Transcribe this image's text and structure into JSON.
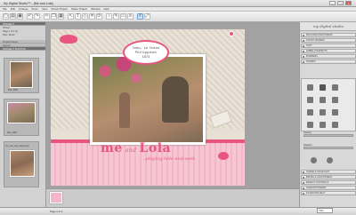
{
  "window": {
    "title": "My Digital Studio™ - [Me and Lola]"
  },
  "menu": [
    "File",
    "Edit",
    "Arrange",
    "Zoom",
    "View",
    "Check Project",
    "Share Project",
    "Window",
    "Help"
  ],
  "toolbar": {
    "icons": [
      "new-icon",
      "open-icon",
      "save-icon",
      "undo-icon",
      "redo-icon",
      "cut-icon",
      "copy-icon",
      "paste-icon",
      "select-icon",
      "text-icon",
      "shape-icon",
      "crop-icon",
      "rotate-icon",
      "music-icon",
      "pen-icon",
      "eraser-icon",
      "align-icon",
      "grid-icon",
      "fullscreen-icon"
    ]
  },
  "left_panel": {
    "tabs": [
      "PROJECT",
      "Project Panel",
      "Layout",
      "PROJECT PHOTOS"
    ],
    "info_lines": [
      "Photos",
      "Page 1 of 2 (1)",
      "Size: 12x12"
    ],
    "photos": [
      "IMG_0081",
      "IMG_0082",
      "me_and_lola_original.jpg"
    ]
  },
  "page": {
    "label_lines": [
      "Cebu, Le Union",
      "Philippines",
      "1973"
    ],
    "title_me": "me",
    "title_and": "and",
    "title_lola": "Lola",
    "subtitle": "...playing hide-and-seek"
  },
  "right_panel": {
    "brand": "my digital studio",
    "sections": [
      "BACKGROUND PAPERS",
      "PHOTO FRAMES",
      "TEXT",
      "EMBELLISHMENTS",
      "BORDERS",
      "STAMPS"
    ],
    "bottom_sections": [
      "SHADE & HIGHLIGHT",
      "BRUSH & ADJUSTMENT",
      "EFFECT CONTROLS",
      "SHADOW PRESET",
      "FILTER PROJECT"
    ],
    "slider_labels": [
      "Opacity",
      "Rotation"
    ]
  },
  "status": {
    "page_text": "Page 1 of 2",
    "zoom": "74%"
  },
  "colors": {
    "accent": "#e8557f",
    "band": "#f7c6d4"
  }
}
